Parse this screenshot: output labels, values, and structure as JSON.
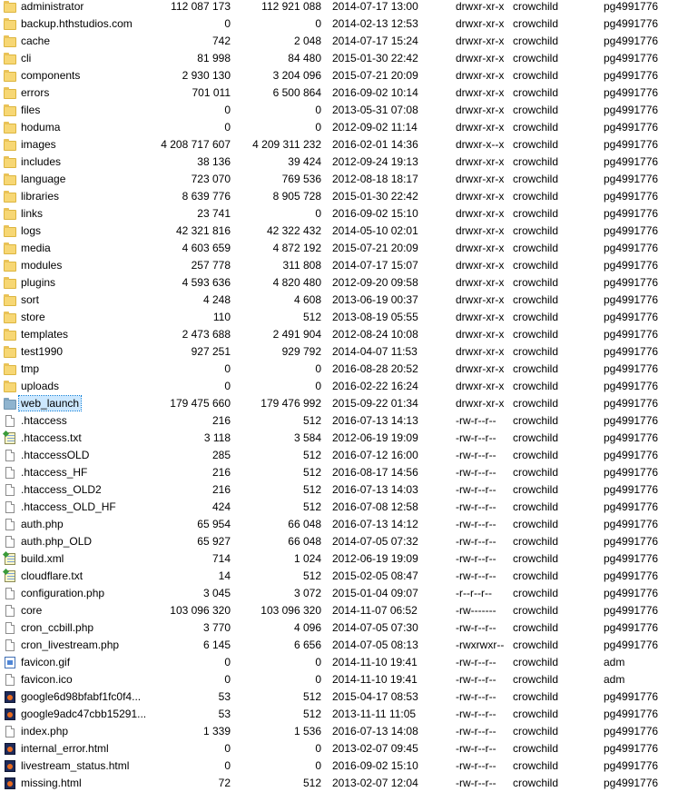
{
  "files": [
    {
      "name": "administrator",
      "size": "112 087 173",
      "alloc": "112 921 088",
      "date": "2014-07-17 13:00",
      "perm": "drwxr-xr-x",
      "owner": "crowchild",
      "group": "pg4991776",
      "icon": "folder-icon"
    },
    {
      "name": "backup.hthstudios.com",
      "size": "0",
      "alloc": "0",
      "date": "2014-02-13 12:53",
      "perm": "drwxr-xr-x",
      "owner": "crowchild",
      "group": "pg4991776",
      "icon": "folder-icon"
    },
    {
      "name": "cache",
      "size": "742",
      "alloc": "2 048",
      "date": "2014-07-17 15:24",
      "perm": "drwxr-xr-x",
      "owner": "crowchild",
      "group": "pg4991776",
      "icon": "folder-icon"
    },
    {
      "name": "cli",
      "size": "81 998",
      "alloc": "84 480",
      "date": "2015-01-30 22:42",
      "perm": "drwxr-xr-x",
      "owner": "crowchild",
      "group": "pg4991776",
      "icon": "folder-icon"
    },
    {
      "name": "components",
      "size": "2 930 130",
      "alloc": "3 204 096",
      "date": "2015-07-21 20:09",
      "perm": "drwxr-xr-x",
      "owner": "crowchild",
      "group": "pg4991776",
      "icon": "folder-icon"
    },
    {
      "name": "errors",
      "size": "701 011",
      "alloc": "6 500 864",
      "date": "2016-09-02 10:14",
      "perm": "drwxr-xr-x",
      "owner": "crowchild",
      "group": "pg4991776",
      "icon": "folder-icon"
    },
    {
      "name": "files",
      "size": "0",
      "alloc": "0",
      "date": "2013-05-31 07:08",
      "perm": "drwxr-xr-x",
      "owner": "crowchild",
      "group": "pg4991776",
      "icon": "folder-icon"
    },
    {
      "name": "hoduma",
      "size": "0",
      "alloc": "0",
      "date": "2012-09-02 11:14",
      "perm": "drwxr-xr-x",
      "owner": "crowchild",
      "group": "pg4991776",
      "icon": "folder-icon"
    },
    {
      "name": "images",
      "size": "4 208 717 607",
      "alloc": "4 209 311 232",
      "date": "2016-02-01 14:36",
      "perm": "drwxr-x--x",
      "owner": "crowchild",
      "group": "pg4991776",
      "icon": "folder-icon"
    },
    {
      "name": "includes",
      "size": "38 136",
      "alloc": "39 424",
      "date": "2012-09-24 19:13",
      "perm": "drwxr-xr-x",
      "owner": "crowchild",
      "group": "pg4991776",
      "icon": "folder-icon"
    },
    {
      "name": "language",
      "size": "723 070",
      "alloc": "769 536",
      "date": "2012-08-18 18:17",
      "perm": "drwxr-xr-x",
      "owner": "crowchild",
      "group": "pg4991776",
      "icon": "folder-icon"
    },
    {
      "name": "libraries",
      "size": "8 639 776",
      "alloc": "8 905 728",
      "date": "2015-01-30 22:42",
      "perm": "drwxr-xr-x",
      "owner": "crowchild",
      "group": "pg4991776",
      "icon": "folder-icon"
    },
    {
      "name": "links",
      "size": "23 741",
      "alloc": "0",
      "date": "2016-09-02 15:10",
      "perm": "drwxr-xr-x",
      "owner": "crowchild",
      "group": "pg4991776",
      "icon": "folder-icon"
    },
    {
      "name": "logs",
      "size": "42 321 816",
      "alloc": "42 322 432",
      "date": "2014-05-10 02:01",
      "perm": "drwxr-xr-x",
      "owner": "crowchild",
      "group": "pg4991776",
      "icon": "folder-icon"
    },
    {
      "name": "media",
      "size": "4 603 659",
      "alloc": "4 872 192",
      "date": "2015-07-21 20:09",
      "perm": "drwxr-xr-x",
      "owner": "crowchild",
      "group": "pg4991776",
      "icon": "folder-icon"
    },
    {
      "name": "modules",
      "size": "257 778",
      "alloc": "311 808",
      "date": "2014-07-17 15:07",
      "perm": "drwxr-xr-x",
      "owner": "crowchild",
      "group": "pg4991776",
      "icon": "folder-icon"
    },
    {
      "name": "plugins",
      "size": "4 593 636",
      "alloc": "4 820 480",
      "date": "2012-09-20 09:58",
      "perm": "drwxr-xr-x",
      "owner": "crowchild",
      "group": "pg4991776",
      "icon": "folder-icon"
    },
    {
      "name": "sort",
      "size": "4 248",
      "alloc": "4 608",
      "date": "2013-06-19 00:37",
      "perm": "drwxr-xr-x",
      "owner": "crowchild",
      "group": "pg4991776",
      "icon": "folder-icon"
    },
    {
      "name": "store",
      "size": "110",
      "alloc": "512",
      "date": "2013-08-19 05:55",
      "perm": "drwxr-xr-x",
      "owner": "crowchild",
      "group": "pg4991776",
      "icon": "folder-icon"
    },
    {
      "name": "templates",
      "size": "2 473 688",
      "alloc": "2 491 904",
      "date": "2012-08-24 10:08",
      "perm": "drwxr-xr-x",
      "owner": "crowchild",
      "group": "pg4991776",
      "icon": "folder-icon"
    },
    {
      "name": "test1990",
      "size": "927 251",
      "alloc": "929 792",
      "date": "2014-04-07 11:53",
      "perm": "drwxr-xr-x",
      "owner": "crowchild",
      "group": "pg4991776",
      "icon": "folder-icon"
    },
    {
      "name": "tmp",
      "size": "0",
      "alloc": "0",
      "date": "2016-08-28 20:52",
      "perm": "drwxr-xr-x",
      "owner": "crowchild",
      "group": "pg4991776",
      "icon": "folder-icon"
    },
    {
      "name": "uploads",
      "size": "0",
      "alloc": "0",
      "date": "2016-02-22 16:24",
      "perm": "drwxr-xr-x",
      "owner": "crowchild",
      "group": "pg4991776",
      "icon": "folder-icon"
    },
    {
      "name": "web_launch",
      "size": "179 475 660",
      "alloc": "179 476 992",
      "date": "2015-09-22 01:34",
      "perm": "drwxr-xr-x",
      "owner": "crowchild",
      "group": "pg4991776",
      "icon": "folder-icon",
      "selected": true
    },
    {
      "name": ".htaccess",
      "size": "216",
      "alloc": "512",
      "date": "2016-07-13 14:13",
      "perm": "-rw-r--r--",
      "owner": "crowchild",
      "group": "pg4991776",
      "icon": "file-icon"
    },
    {
      "name": ".htaccess.txt",
      "size": "3 118",
      "alloc": "3 584",
      "date": "2012-06-19 19:09",
      "perm": "-rw-r--r--",
      "owner": "crowchild",
      "group": "pg4991776",
      "icon": "notepad-icon"
    },
    {
      "name": ".htaccessOLD",
      "size": "285",
      "alloc": "512",
      "date": "2016-07-12 16:00",
      "perm": "-rw-r--r--",
      "owner": "crowchild",
      "group": "pg4991776",
      "icon": "file-icon"
    },
    {
      "name": ".htaccess_HF",
      "size": "216",
      "alloc": "512",
      "date": "2016-08-17 14:56",
      "perm": "-rw-r--r--",
      "owner": "crowchild",
      "group": "pg4991776",
      "icon": "file-icon"
    },
    {
      "name": ".htaccess_OLD2",
      "size": "216",
      "alloc": "512",
      "date": "2016-07-13 14:03",
      "perm": "-rw-r--r--",
      "owner": "crowchild",
      "group": "pg4991776",
      "icon": "file-icon"
    },
    {
      "name": ".htaccess_OLD_HF",
      "size": "424",
      "alloc": "512",
      "date": "2016-07-08 12:58",
      "perm": "-rw-r--r--",
      "owner": "crowchild",
      "group": "pg4991776",
      "icon": "file-icon"
    },
    {
      "name": "auth.php",
      "size": "65 954",
      "alloc": "66 048",
      "date": "2016-07-13 14:12",
      "perm": "-rw-r--r--",
      "owner": "crowchild",
      "group": "pg4991776",
      "icon": "file-icon"
    },
    {
      "name": "auth.php_OLD",
      "size": "65 927",
      "alloc": "66 048",
      "date": "2014-07-05 07:32",
      "perm": "-rw-r--r--",
      "owner": "crowchild",
      "group": "pg4991776",
      "icon": "file-icon"
    },
    {
      "name": "build.xml",
      "size": "714",
      "alloc": "1 024",
      "date": "2012-06-19 19:09",
      "perm": "-rw-r--r--",
      "owner": "crowchild",
      "group": "pg4991776",
      "icon": "notepad-icon"
    },
    {
      "name": "cloudflare.txt",
      "size": "14",
      "alloc": "512",
      "date": "2015-02-05 08:47",
      "perm": "-rw-r--r--",
      "owner": "crowchild",
      "group": "pg4991776",
      "icon": "notepad-icon"
    },
    {
      "name": "configuration.php",
      "size": "3 045",
      "alloc": "3 072",
      "date": "2015-01-04 09:07",
      "perm": "-r--r--r--",
      "owner": "crowchild",
      "group": "pg4991776",
      "icon": "file-icon"
    },
    {
      "name": "core",
      "size": "103 096 320",
      "alloc": "103 096 320",
      "date": "2014-11-07 06:52",
      "perm": "-rw-------",
      "owner": "crowchild",
      "group": "pg4991776",
      "icon": "file-icon"
    },
    {
      "name": "cron_ccbill.php",
      "size": "3 770",
      "alloc": "4 096",
      "date": "2014-07-05 07:30",
      "perm": "-rw-r--r--",
      "owner": "crowchild",
      "group": "pg4991776",
      "icon": "file-icon"
    },
    {
      "name": "cron_livestream.php",
      "size": "6 145",
      "alloc": "6 656",
      "date": "2014-07-05 08:13",
      "perm": "-rwxrwxr--",
      "owner": "crowchild",
      "group": "pg4991776",
      "icon": "file-icon"
    },
    {
      "name": "favicon.gif",
      "size": "0",
      "alloc": "0",
      "date": "2014-11-10 19:41",
      "perm": "-rw-r--r--",
      "owner": "crowchild",
      "group": "adm",
      "icon": "image-icon"
    },
    {
      "name": "favicon.ico",
      "size": "0",
      "alloc": "0",
      "date": "2014-11-10 19:41",
      "perm": "-rw-r--r--",
      "owner": "crowchild",
      "group": "adm",
      "icon": "file-icon"
    },
    {
      "name": "google6d98bfabf1fc0f4...",
      "size": "53",
      "alloc": "512",
      "date": "2015-04-17 08:53",
      "perm": "-rw-r--r--",
      "owner": "crowchild",
      "group": "pg4991776",
      "icon": "browser-icon"
    },
    {
      "name": "google9adc47cbb15291...",
      "size": "53",
      "alloc": "512",
      "date": "2013-11-11 11:05",
      "perm": "-rw-r--r--",
      "owner": "crowchild",
      "group": "pg4991776",
      "icon": "browser-icon"
    },
    {
      "name": "index.php",
      "size": "1 339",
      "alloc": "1 536",
      "date": "2016-07-13 14:08",
      "perm": "-rw-r--r--",
      "owner": "crowchild",
      "group": "pg4991776",
      "icon": "file-icon"
    },
    {
      "name": "internal_error.html",
      "size": "0",
      "alloc": "0",
      "date": "2013-02-07 09:45",
      "perm": "-rw-r--r--",
      "owner": "crowchild",
      "group": "pg4991776",
      "icon": "browser-icon"
    },
    {
      "name": "livestream_status.html",
      "size": "0",
      "alloc": "0",
      "date": "2016-09-02 15:10",
      "perm": "-rw-r--r--",
      "owner": "crowchild",
      "group": "pg4991776",
      "icon": "browser-icon"
    },
    {
      "name": "missing.html",
      "size": "72",
      "alloc": "512",
      "date": "2013-02-07 12:04",
      "perm": "-rw-r--r--",
      "owner": "crowchild",
      "group": "pg4991776",
      "icon": "browser-icon"
    }
  ]
}
